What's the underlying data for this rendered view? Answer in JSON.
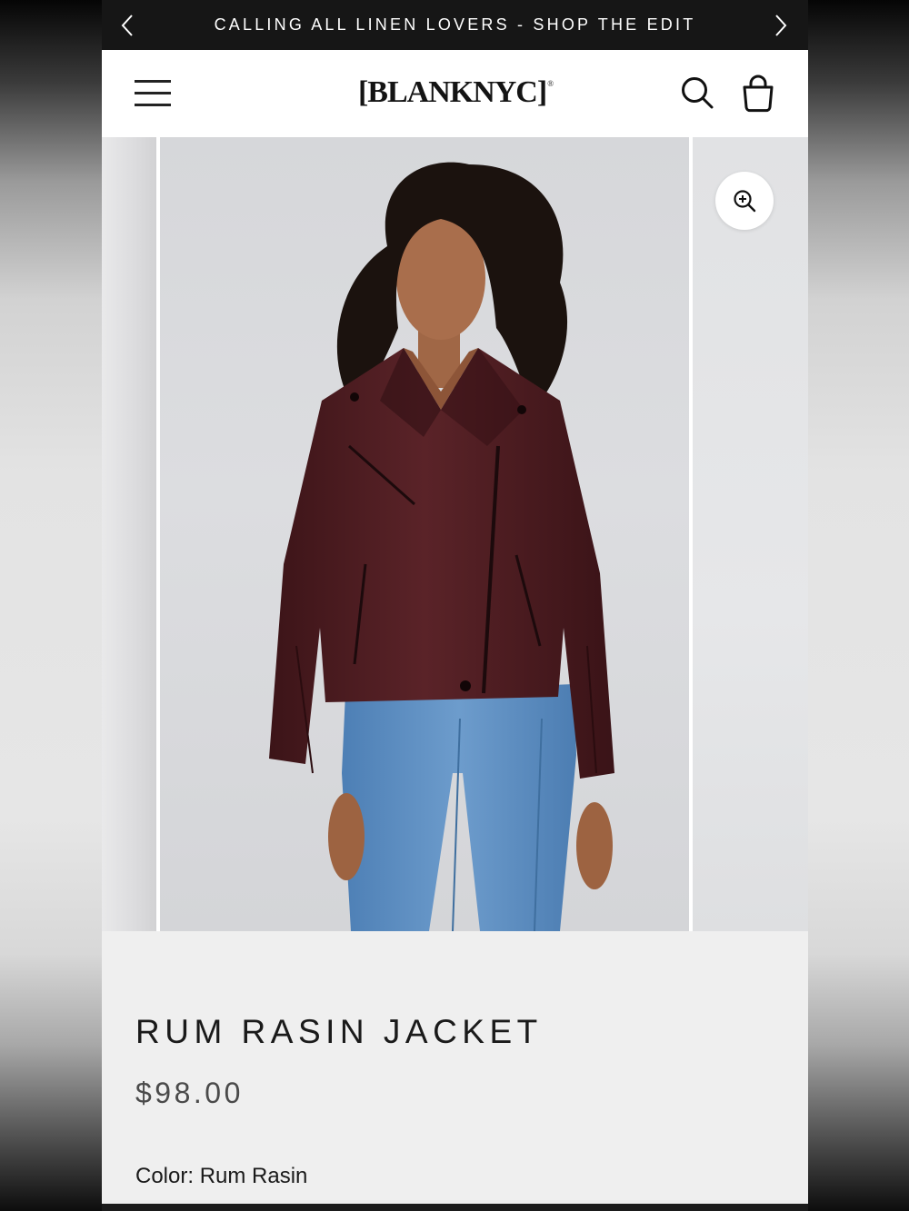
{
  "announcement": {
    "text": "CALLING ALL LINEN LOVERS - SHOP THE EDIT",
    "prev_icon": "chevron-left-icon",
    "next_icon": "chevron-right-icon"
  },
  "header": {
    "logo": "[BLANKNYC]",
    "logo_mark": "®",
    "menu_icon": "hamburger-menu-icon",
    "search_icon": "search-icon",
    "cart_icon": "shopping-bag-icon"
  },
  "gallery": {
    "image_alt": "Model wearing burgundy faux leather moto jacket and blue jeans",
    "zoom_icon": "zoom-in-icon"
  },
  "product": {
    "title": "RUM RASIN JACKET",
    "price": "$98.00",
    "color_label": "Color:",
    "color_value": "Rum Rasin"
  },
  "colors": {
    "announcement_bg": "#161616",
    "header_bg": "#ffffff",
    "jacket": "#4a1a1e",
    "jeans": "#5b8cc0",
    "info_bg": "#efefef"
  }
}
